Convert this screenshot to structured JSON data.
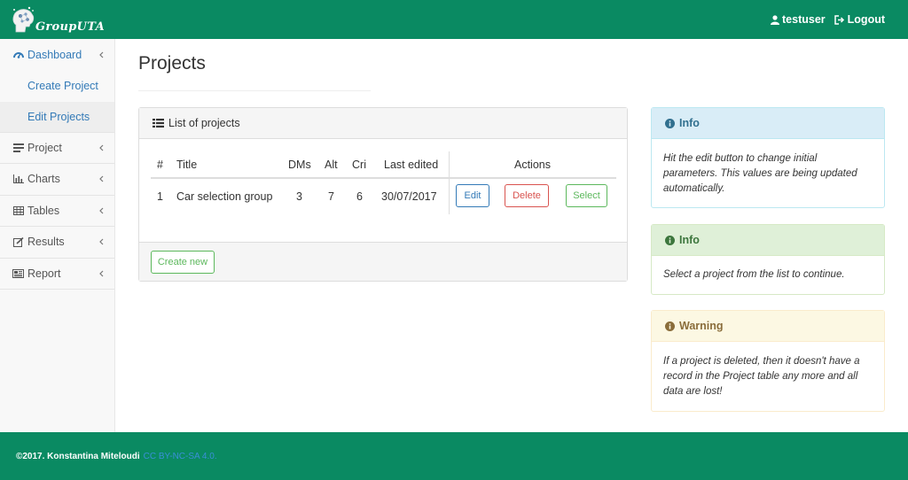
{
  "header": {
    "brand": "GroupUTA",
    "user": "testuser",
    "logout": "Logout"
  },
  "sidebar": {
    "items": [
      {
        "label": "Dashboard",
        "icon": "dashboard-icon"
      },
      {
        "label": "Project",
        "icon": "list-icon"
      },
      {
        "label": "Charts",
        "icon": "bar-chart-icon"
      },
      {
        "label": "Tables",
        "icon": "table-icon"
      },
      {
        "label": "Results",
        "icon": "edit-icon"
      },
      {
        "label": "Report",
        "icon": "newspaper-icon"
      }
    ],
    "sub_items": [
      {
        "label": "Create Project"
      },
      {
        "label": "Edit Projects"
      }
    ]
  },
  "main": {
    "title": "Projects",
    "panel_title": "List of projects",
    "table": {
      "headers": [
        "#",
        "Title",
        "DMs",
        "Alt",
        "Cri",
        "Last edited",
        "Actions"
      ],
      "rows": [
        {
          "num": "1",
          "title": "Car selection group",
          "dms": "3",
          "alt": "7",
          "cri": "6",
          "last_edited": "30/07/2017"
        }
      ],
      "actions": {
        "edit": "Edit",
        "delete": "Delete",
        "select": "Select"
      }
    },
    "create_button": "Create new"
  },
  "info_panels": [
    {
      "title": "Info",
      "body": "Hit the edit button to change initial parameters. This values are being updated automatically."
    },
    {
      "title": "Info",
      "body": "Select a project from the list to continue."
    },
    {
      "title": "Warning",
      "body": "If a project is deleted, then it doesn't have a record in the Project table any more and all data are lost!"
    }
  ],
  "footer": {
    "copyright": "©2017. Konstantina Miteloudi",
    "license": "CC BY-NC-SA 4.0."
  },
  "colors": {
    "brand_green": "#0a8a62",
    "link_blue": "#337ab7",
    "danger": "#d9534f",
    "success": "#5cb85c"
  }
}
